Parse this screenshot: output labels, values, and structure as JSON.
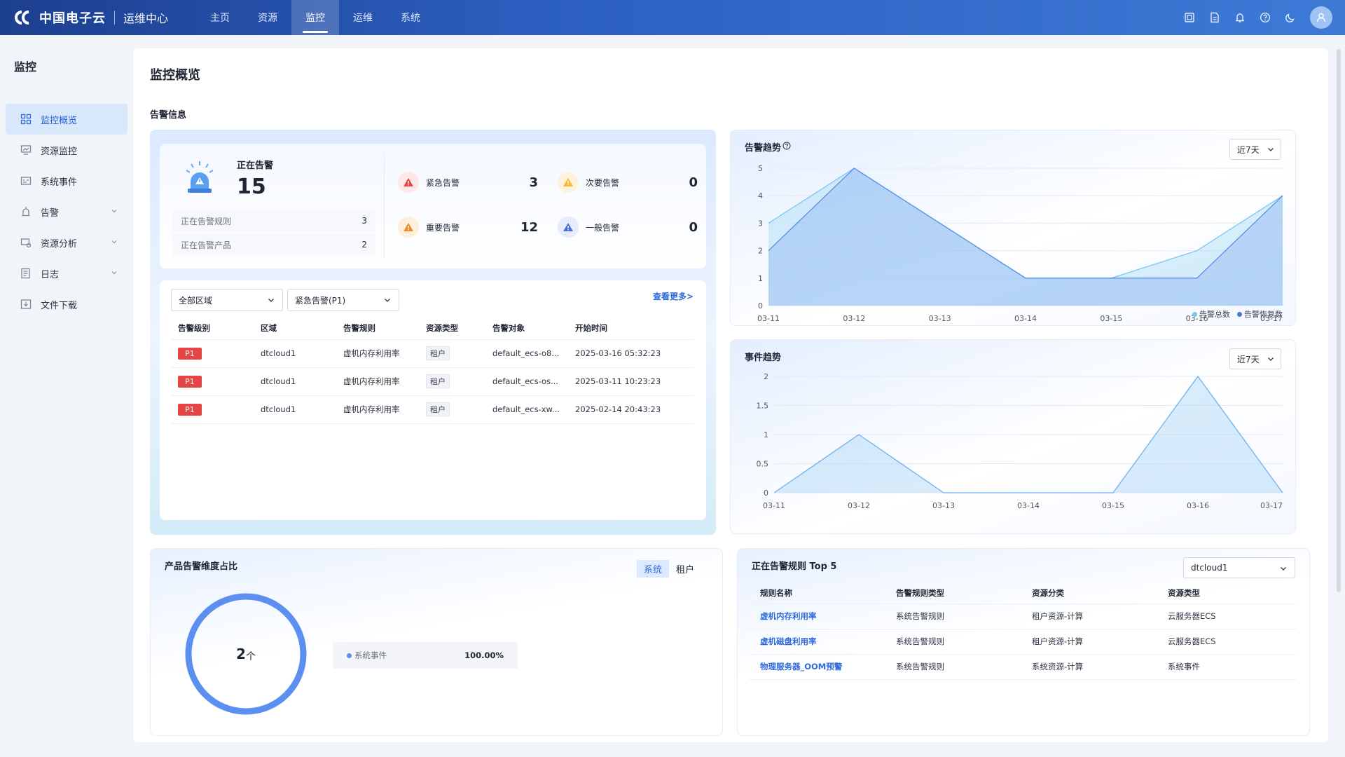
{
  "brand": {
    "name": "中国电子云",
    "subtitle": "运维中心"
  },
  "topnav": [
    {
      "label": "主页"
    },
    {
      "label": "资源"
    },
    {
      "label": "监控"
    },
    {
      "label": "运维"
    },
    {
      "label": "系统"
    }
  ],
  "sidebar": {
    "title": "监控",
    "items": [
      {
        "label": "监控概览",
        "icon": "grid-icon"
      },
      {
        "label": "资源监控",
        "icon": "monitor-icon"
      },
      {
        "label": "系统事件",
        "icon": "event-icon"
      },
      {
        "label": "告警",
        "icon": "alarm-icon"
      },
      {
        "label": "资源分析",
        "icon": "analysis-icon"
      },
      {
        "label": "日志",
        "icon": "log-icon"
      },
      {
        "label": "文件下载",
        "icon": "download-icon"
      }
    ]
  },
  "page": {
    "title": "监控概览",
    "section": "告警信息"
  },
  "summary": {
    "label": "正在告警",
    "count": "15",
    "rules_label": "正在告警规则",
    "rules_value": "3",
    "products_label": "正在告警产品",
    "products_value": "2",
    "severity": [
      {
        "label": "紧急告警",
        "value": "3",
        "color": "#e54545"
      },
      {
        "label": "次要告警",
        "value": "0",
        "color": "#f5b82e"
      },
      {
        "label": "重要告警",
        "value": "12",
        "color": "#f08a24"
      },
      {
        "label": "一般告警",
        "value": "0",
        "color": "#4a6fd8"
      }
    ]
  },
  "alarmList": {
    "region_select": "全部区域",
    "level_select": "紧急告警(P1)",
    "more": "查看更多>",
    "headers": [
      "告警级别",
      "区域",
      "告警规则",
      "资源类型",
      "告警对象",
      "开始时间"
    ],
    "rows": [
      {
        "level": "P1",
        "region": "dtcloud1",
        "rule": "虚机内存利用率",
        "type": "租户",
        "object": "default_ecs-o8...",
        "time": "2025-03-16 05:32:23"
      },
      {
        "level": "P1",
        "region": "dtcloud1",
        "rule": "虚机内存利用率",
        "type": "租户",
        "object": "default_ecs-os...",
        "time": "2025-03-11 10:23:23"
      },
      {
        "level": "P1",
        "region": "dtcloud1",
        "rule": "虚机内存利用率",
        "type": "租户",
        "object": "default_ecs-xw...",
        "time": "2025-02-14 20:43:23"
      }
    ]
  },
  "trend": {
    "title": "告警趋势",
    "range": "近7天",
    "legend": [
      "告警总数",
      "告警恢复数"
    ]
  },
  "event": {
    "title": "事件趋势",
    "range": "近7天"
  },
  "chart_data": [
    {
      "type": "area",
      "x": [
        "03-11",
        "03-12",
        "03-13",
        "03-14",
        "03-15",
        "03-16",
        "03-17"
      ],
      "series": [
        {
          "name": "告警总数",
          "values": [
            3,
            5,
            3,
            1,
            1,
            2,
            4
          ]
        },
        {
          "name": "告警恢复数",
          "values": [
            2,
            5,
            3,
            1,
            1,
            1,
            4
          ]
        }
      ],
      "ylim": [
        0,
        5
      ],
      "yticks": [
        0,
        1,
        2,
        3,
        4,
        5
      ]
    },
    {
      "type": "area",
      "x": [
        "03-11",
        "03-12",
        "03-13",
        "03-14",
        "03-15",
        "03-16",
        "03-17"
      ],
      "series": [
        {
          "values": [
            0,
            1,
            0,
            0,
            0,
            2,
            0
          ]
        }
      ],
      "ylim": [
        0,
        2
      ],
      "yticks": [
        0,
        0.5,
        1,
        1.5,
        2
      ]
    }
  ],
  "ratio": {
    "title": "产品告警维度占比",
    "tabs": [
      "系统",
      "租户"
    ],
    "center_value": "2",
    "center_unit": "个",
    "row_label": "系统事件",
    "row_pct": "100.00%",
    "fraction": 1.0
  },
  "top5": {
    "title": "正在告警规则 Top 5",
    "region": "dtcloud1",
    "headers": [
      "规则名称",
      "告警规则类型",
      "资源分类",
      "资源类型"
    ],
    "rows": [
      {
        "name": "虚机内存利用率",
        "type": "系统告警规则",
        "category": "租户资源-计算",
        "resource": "云服务器ECS"
      },
      {
        "name": "虚机磁盘利用率",
        "type": "系统告警规则",
        "category": "租户资源-计算",
        "resource": "云服务器ECS"
      },
      {
        "name": "物理服务器_OOM预警",
        "type": "系统告警规则",
        "category": "系统资源-计算",
        "resource": "系统事件"
      }
    ]
  }
}
